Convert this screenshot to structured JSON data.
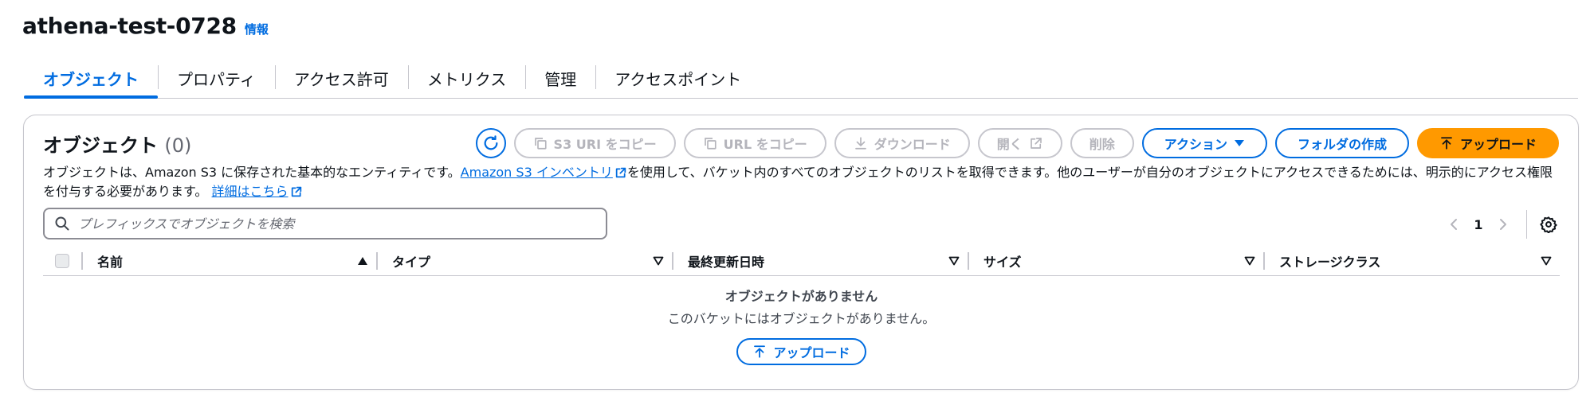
{
  "bucket": {
    "name": "athena-test-0728",
    "info_label": "情報"
  },
  "tabs": [
    {
      "label": "オブジェクト",
      "active": true
    },
    {
      "label": "プロパティ"
    },
    {
      "label": "アクセス許可"
    },
    {
      "label": "メトリクス"
    },
    {
      "label": "管理"
    },
    {
      "label": "アクセスポイント"
    }
  ],
  "objects_panel": {
    "title": "オブジェクト",
    "count": "(0)",
    "description": {
      "part1": "オブジェクトは、Amazon S3 に保存された基本的なエンティティです。",
      "inventory_link": "Amazon S3 インベントリ",
      "part2": "を使用して、バケット内のすべてのオブジェクトのリストを取得できます。他のユーザーが自分のオブジェクトにアクセスできるためには、明示的にアクセス権限を付与する必要があります。",
      "details_link": "詳細はこちら"
    },
    "toolbar": {
      "copy_s3_uri": "S3 URI をコピー",
      "copy_url": "URL をコピー",
      "download": "ダウンロード",
      "open": "開く",
      "delete": "削除",
      "actions": "アクション",
      "create_folder": "フォルダの作成",
      "upload": "アップロード"
    },
    "search": {
      "placeholder": "プレフィックスでオブジェクトを検索"
    },
    "pagination": {
      "current_page": "1"
    },
    "table": {
      "columns": [
        "名前",
        "タイプ",
        "最終更新日時",
        "サイズ",
        "ストレージクラス"
      ]
    },
    "empty_state": {
      "title": "オブジェクトがありません",
      "subtitle": "このバケットにはオブジェクトがありません。",
      "upload_button": "アップロード"
    }
  },
  "colors": {
    "link": "#006ce0",
    "primary_button": "#ff9900",
    "disabled_text": "#b4b4bb",
    "border": "#c6c6cd"
  }
}
